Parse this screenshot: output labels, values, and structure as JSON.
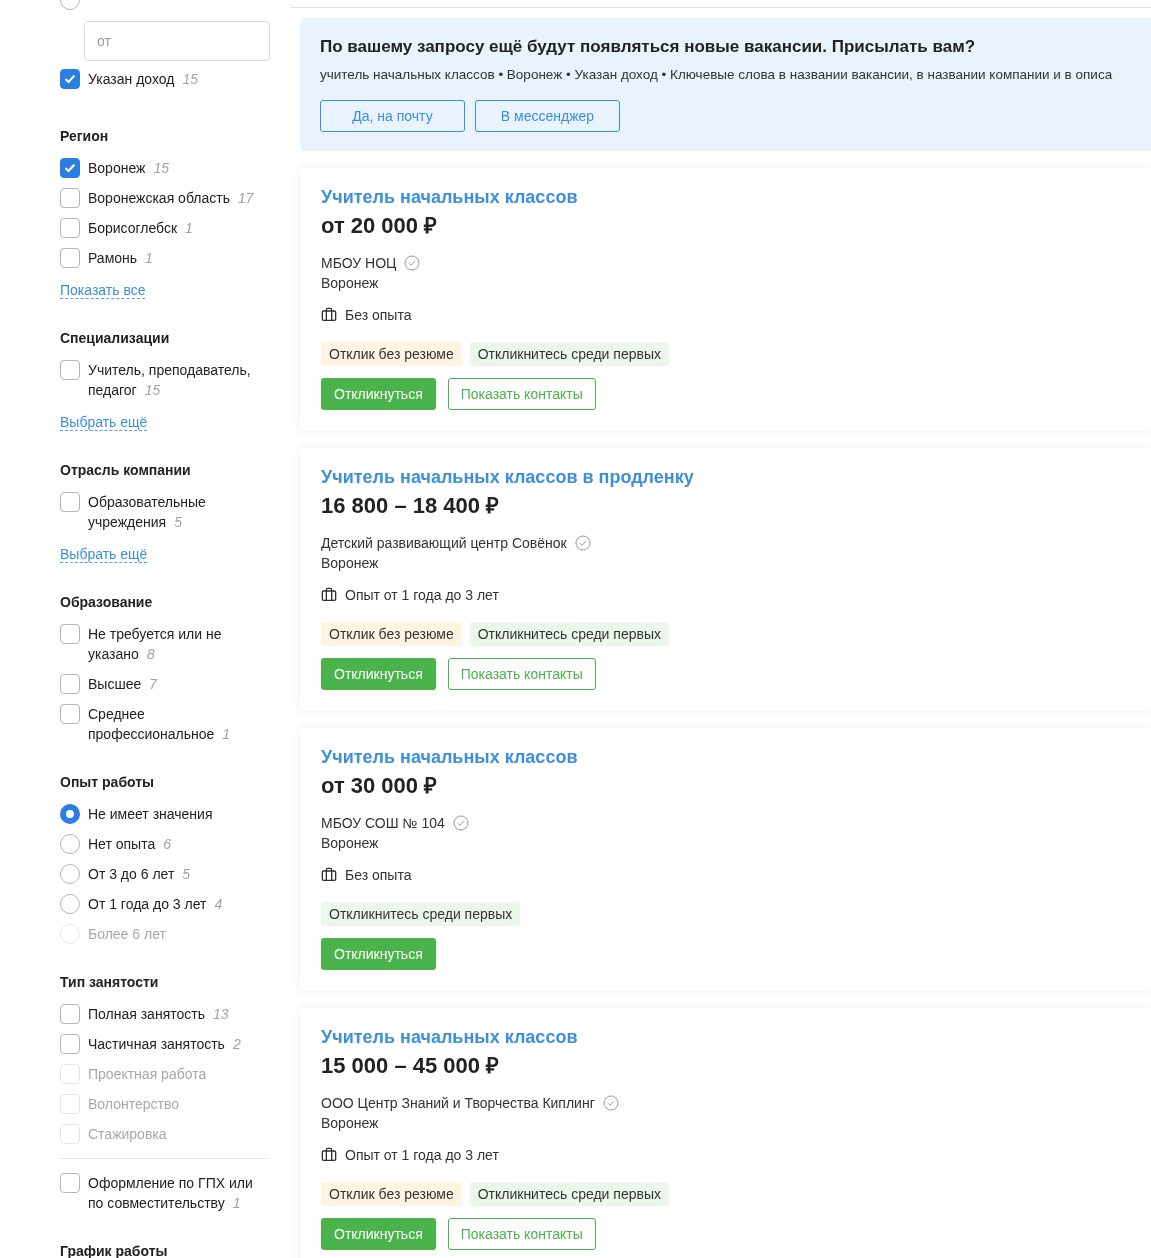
{
  "salary": {
    "custom_option_selected": false,
    "input_placeholder": "от",
    "income_filter": {
      "label": "Указан доход",
      "count": "15",
      "checked": true,
      "disabled": false
    }
  },
  "filters": [
    {
      "title": "Регион",
      "items": [
        {
          "kind": "checkbox",
          "label": "Воронеж",
          "count": "15",
          "checked": true,
          "disabled": false
        },
        {
          "kind": "checkbox",
          "label": "Воронежская область",
          "count": "17",
          "checked": false,
          "disabled": false
        },
        {
          "kind": "checkbox",
          "label": "Борисоглебск",
          "count": "1",
          "checked": false,
          "disabled": false
        },
        {
          "kind": "checkbox",
          "label": "Рамонь",
          "count": "1",
          "checked": false,
          "disabled": false
        }
      ],
      "link": "Показать все"
    },
    {
      "title": "Специализации",
      "items": [
        {
          "kind": "checkbox",
          "label": "Учитель, преподаватель, педагог",
          "count": "15",
          "checked": false,
          "disabled": false
        }
      ],
      "link": "Выбрать ещё"
    },
    {
      "title": "Отрасль компании",
      "items": [
        {
          "kind": "checkbox",
          "label": "Образовательные учреждения",
          "count": "5",
          "checked": false,
          "disabled": false
        }
      ],
      "link": "Выбрать ещё"
    },
    {
      "title": "Образование",
      "items": [
        {
          "kind": "checkbox",
          "label": "Не требуется или не указано",
          "count": "8",
          "checked": false,
          "disabled": false
        },
        {
          "kind": "checkbox",
          "label": "Высшее",
          "count": "7",
          "checked": false,
          "disabled": false
        },
        {
          "kind": "checkbox",
          "label": "Среднее профессиональное",
          "count": "1",
          "checked": false,
          "disabled": false
        }
      ]
    },
    {
      "title": "Опыт работы",
      "items": [
        {
          "kind": "radio",
          "label": "Не имеет значения",
          "selected": true,
          "disabled": false
        },
        {
          "kind": "radio",
          "label": "Нет опыта",
          "count": "6",
          "selected": false,
          "disabled": false
        },
        {
          "kind": "radio",
          "label": "От 3 до 6 лет",
          "count": "5",
          "selected": false,
          "disabled": false
        },
        {
          "kind": "radio",
          "label": "От 1 года до 3 лет",
          "count": "4",
          "selected": false,
          "disabled": false
        },
        {
          "kind": "radio",
          "label": "Более 6 лет",
          "selected": false,
          "disabled": true
        }
      ]
    },
    {
      "title": "Тип занятости",
      "items": [
        {
          "kind": "checkbox",
          "label": "Полная занятость",
          "count": "13",
          "checked": false,
          "disabled": false
        },
        {
          "kind": "checkbox",
          "label": "Частичная занятость",
          "count": "2",
          "checked": false,
          "disabled": false
        },
        {
          "kind": "checkbox",
          "label": "Проектная работа",
          "checked": false,
          "disabled": true
        },
        {
          "kind": "checkbox",
          "label": "Волонтерство",
          "checked": false,
          "disabled": true
        },
        {
          "kind": "checkbox",
          "label": "Стажировка",
          "checked": false,
          "disabled": true
        }
      ],
      "after_divider": [
        {
          "kind": "checkbox",
          "label": "Оформление по ГПХ или по совместительству",
          "count": "1",
          "checked": false,
          "disabled": false
        }
      ]
    },
    {
      "title": "График работы"
    }
  ],
  "subscribe_banner": {
    "title": "По вашему запросу ещё будут появляться новые вакансии. Присылать вам?",
    "query": "учитель начальных классов • Воронеж • Указан доход • Ключевые слова в названии вакансии, в названии компании и в описа",
    "buttons": [
      "Да, на почту",
      "В мессенджер"
    ]
  },
  "vacancies": [
    {
      "title": "Учитель начальных классов",
      "salary": "от 20 000 ₽",
      "company": "МБОУ НОЦ",
      "verified": true,
      "city": "Воронеж",
      "experience": "Без опыта",
      "tags": [
        {
          "kind": "no_resume",
          "label": "Отклик без резюме"
        },
        {
          "kind": "early",
          "label": "Откликнитесь среди первых"
        }
      ],
      "buttons": [
        {
          "kind": "primary",
          "label": "Откликнуться"
        },
        {
          "kind": "secondary",
          "label": "Показать контакты"
        }
      ]
    },
    {
      "title": "Учитель начальных классов в продленку",
      "salary": "16 800 – 18 400 ₽",
      "company": "Детский развивающий центр Совёнок",
      "verified": true,
      "city": "Воронеж",
      "experience": "Опыт от 1 года до 3 лет",
      "tags": [
        {
          "kind": "no_resume",
          "label": "Отклик без резюме"
        },
        {
          "kind": "early",
          "label": "Откликнитесь среди первых"
        }
      ],
      "buttons": [
        {
          "kind": "primary",
          "label": "Откликнуться"
        },
        {
          "kind": "secondary",
          "label": "Показать контакты"
        }
      ]
    },
    {
      "title": "Учитель начальных классов",
      "salary": "от 30 000 ₽",
      "company": "МБОУ СОШ № 104",
      "verified": true,
      "city": "Воронеж",
      "experience": "Без опыта",
      "tags": [
        {
          "kind": "early",
          "label": "Откликнитесь среди первых"
        }
      ],
      "buttons": [
        {
          "kind": "primary",
          "label": "Откликнуться"
        }
      ]
    },
    {
      "title": "Учитель начальных классов",
      "salary": "15 000 – 45 000 ₽",
      "company": "ООО Центр Знаний и Творчества Киплинг",
      "verified": true,
      "city": "Воронеж",
      "experience": "Опыт от 1 года до 3 лет",
      "tags": [
        {
          "kind": "no_resume",
          "label": "Отклик без резюме"
        },
        {
          "kind": "early",
          "label": "Откликнитесь среди первых"
        }
      ],
      "buttons": [
        {
          "kind": "primary",
          "label": "Откликнуться"
        },
        {
          "kind": "secondary",
          "label": "Показать контакты"
        }
      ]
    }
  ]
}
